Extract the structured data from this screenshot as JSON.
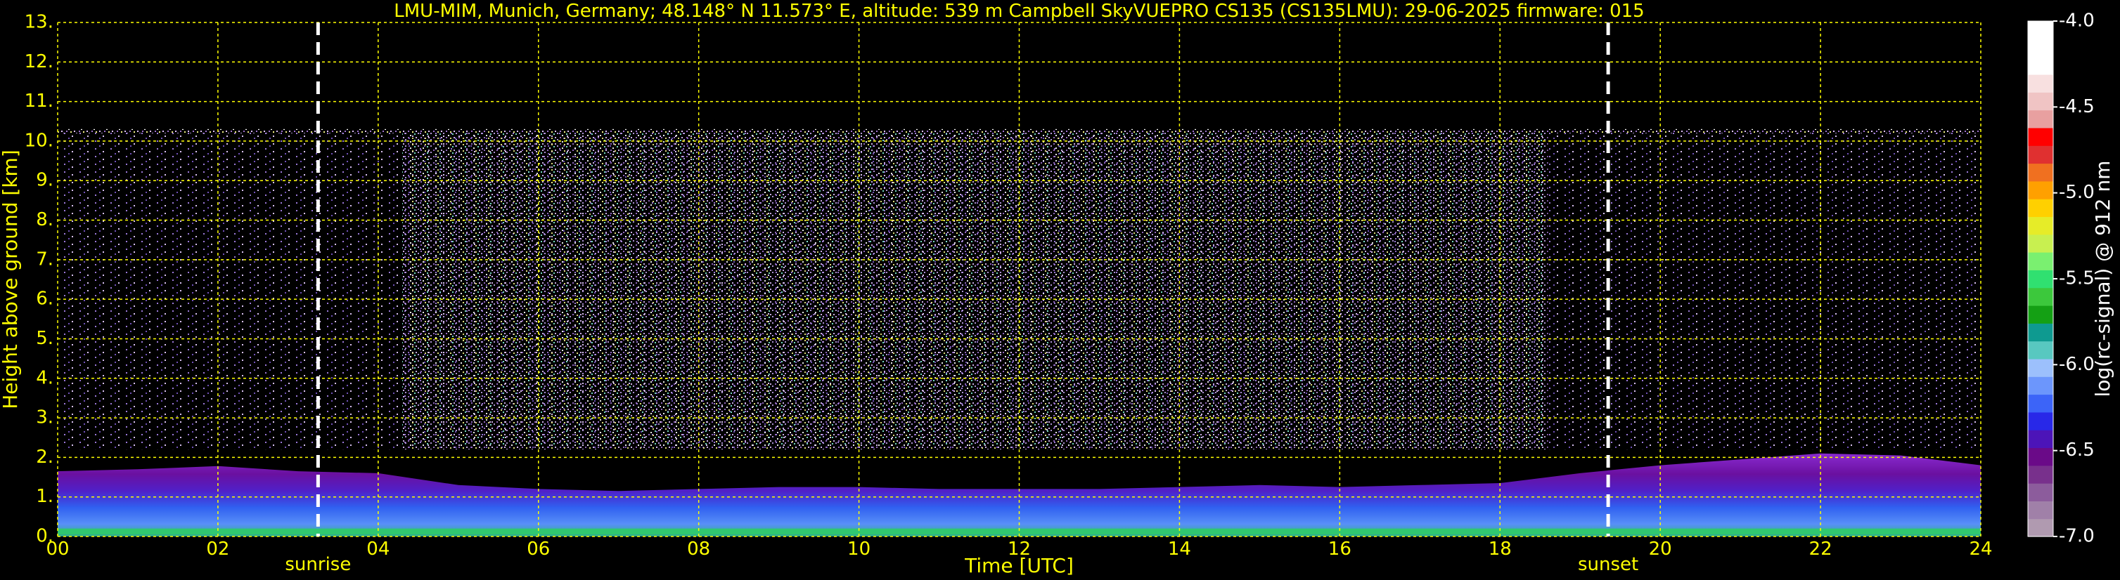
{
  "chart_data": {
    "type": "heatmap",
    "title": "LMU-MIM, Munich, Germany; 48.148° N 11.573° E, altitude: 539 m    Campbell SkyVUEPRO CS135 (CS135LMU): 29-06-2025    firmware: 015",
    "xlabel": "Time [UTC]",
    "ylabel": "Height above ground [km]",
    "xlim": [
      0,
      24
    ],
    "ylim": [
      0,
      13
    ],
    "x_ticks": [
      "00",
      "02",
      "04",
      "06",
      "08",
      "10",
      "12",
      "14",
      "16",
      "18",
      "20",
      "22",
      "24"
    ],
    "x_tick_values": [
      0,
      2,
      4,
      6,
      8,
      10,
      12,
      14,
      16,
      18,
      20,
      22,
      24
    ],
    "y_ticks": [
      "0.",
      "1.",
      "2.",
      "3.",
      "4.",
      "5.",
      "6.",
      "7.",
      "8.",
      "9.",
      "10.",
      "11.",
      "12.",
      "13."
    ],
    "y_tick_values": [
      0,
      1,
      2,
      3,
      4,
      5,
      6,
      7,
      8,
      9,
      10,
      11,
      12,
      13
    ],
    "grid": true,
    "grid_color": "#ffff00",
    "signal_top_km": 10.25,
    "events": [
      {
        "label": "sunrise",
        "time": 3.25
      },
      {
        "label": "sunset",
        "time": 19.35
      }
    ],
    "colorbar": {
      "label": "log(rc-signal) @ 912 nm",
      "range": [
        -7.0,
        -4.0
      ],
      "ticks": [
        "-4.0",
        "-4.5",
        "-5.0",
        "-5.5",
        "-6.0",
        "-6.5",
        "-7.0"
      ],
      "tick_values": [
        -4.0,
        -4.5,
        -5.0,
        -5.5,
        -6.0,
        -6.5,
        -7.0
      ],
      "colors": [
        "#b09ab0",
        "#a080a8",
        "#8c5c9c",
        "#78308c",
        "#6a0a88",
        "#4c14b8",
        "#2828e8",
        "#3c64f8",
        "#6c96fc",
        "#9cc0fc",
        "#58c8c0",
        "#0e9a90",
        "#14a014",
        "#3cc83c",
        "#30e070",
        "#7af070",
        "#c8f050",
        "#e6ec28",
        "#ffd000",
        "#ffa000",
        "#f07020",
        "#e03030",
        "#ff0000",
        "#e8a0a0",
        "#f0c4c4",
        "#f8e0e0",
        "#ffffff",
        "#ffffff",
        "#ffffff"
      ]
    },
    "boundary_layer_top_km": [
      [
        0,
        1.65
      ],
      [
        1,
        1.7
      ],
      [
        2,
        1.78
      ],
      [
        3,
        1.65
      ],
      [
        4,
        1.6
      ],
      [
        5,
        1.3
      ],
      [
        6,
        1.2
      ],
      [
        7,
        1.15
      ],
      [
        8,
        1.2
      ],
      [
        9,
        1.25
      ],
      [
        10,
        1.25
      ],
      [
        11,
        1.2
      ],
      [
        12,
        1.2
      ],
      [
        13,
        1.2
      ],
      [
        14,
        1.25
      ],
      [
        15,
        1.3
      ],
      [
        16,
        1.25
      ],
      [
        17,
        1.3
      ],
      [
        18,
        1.35
      ],
      [
        19,
        1.6
      ],
      [
        20,
        1.8
      ],
      [
        21,
        1.95
      ],
      [
        22,
        2.1
      ],
      [
        23,
        2.05
      ],
      [
        24,
        1.8
      ]
    ]
  }
}
